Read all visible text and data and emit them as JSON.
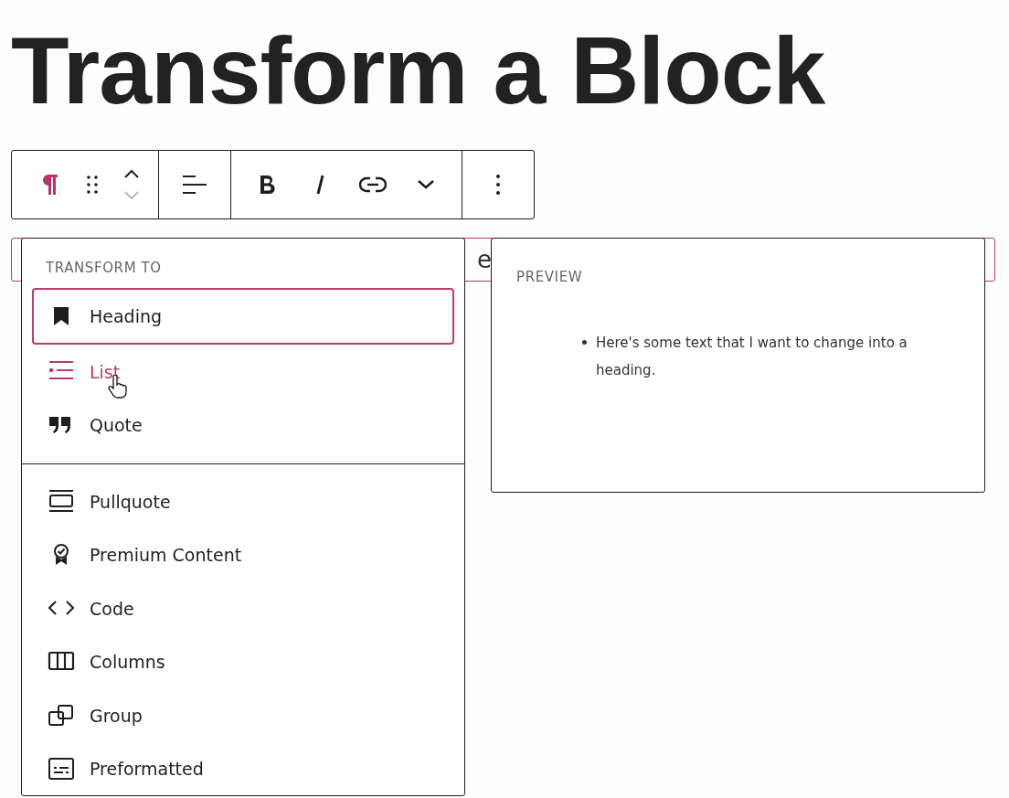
{
  "title": "Transform a Block",
  "toolbar": {
    "groups": [
      [
        {
          "kind": "paragraph",
          "active": true
        },
        {
          "kind": "drag",
          "active": false
        },
        {
          "kind": "movers",
          "up_disabled": false,
          "down_disabled": true
        }
      ],
      [
        {
          "kind": "align",
          "active": false
        }
      ],
      [
        {
          "kind": "bold",
          "active": false
        },
        {
          "kind": "italic",
          "active": false
        },
        {
          "kind": "link",
          "active": false
        },
        {
          "kind": "more",
          "active": false
        }
      ],
      [
        {
          "kind": "options",
          "active": false
        }
      ]
    ]
  },
  "block": {
    "visible_text": "e",
    "selected": true
  },
  "transform_menu": {
    "heading": "TRANSFORM TO",
    "sections": [
      [
        {
          "label": "Heading",
          "kind": "heading",
          "focused": true,
          "hovered": false
        },
        {
          "label": "List",
          "kind": "list",
          "focused": false,
          "hovered": true
        },
        {
          "label": "Quote",
          "kind": "quote",
          "focused": false,
          "hovered": false
        }
      ],
      [
        {
          "label": "Pullquote",
          "kind": "pullquote",
          "focused": false,
          "hovered": false
        },
        {
          "label": "Premium Content",
          "kind": "premium",
          "focused": false,
          "hovered": false
        },
        {
          "label": "Code",
          "kind": "code",
          "focused": false,
          "hovered": false
        },
        {
          "label": "Columns",
          "kind": "columns",
          "focused": false,
          "hovered": false
        },
        {
          "label": "Group",
          "kind": "group",
          "focused": false,
          "hovered": false
        },
        {
          "label": "Preformatted",
          "kind": "preformatted",
          "focused": false,
          "hovered": false
        }
      ]
    ]
  },
  "preview": {
    "heading": "PREVIEW",
    "items": [
      "Here's some text that I want to change into a heading."
    ]
  }
}
